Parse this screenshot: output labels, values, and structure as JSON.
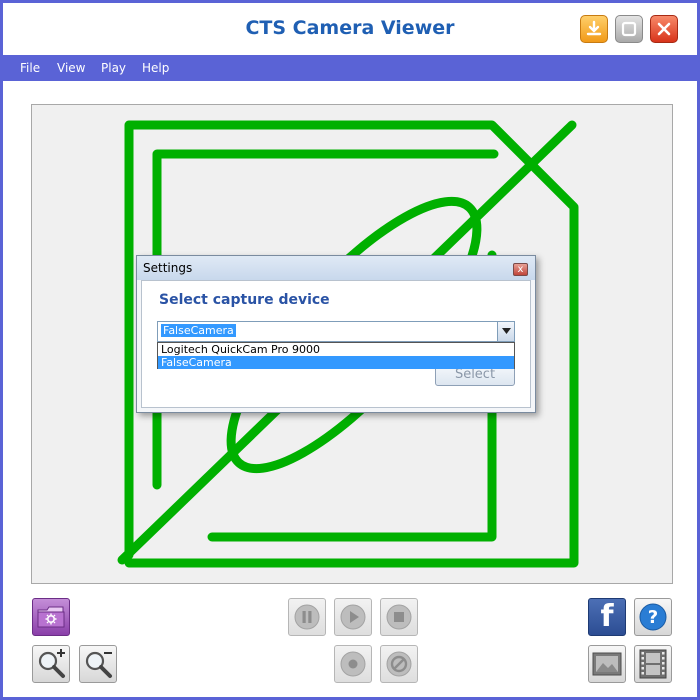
{
  "window": {
    "title": "CTS Camera Viewer"
  },
  "menu": {
    "items": [
      "File",
      "View",
      "Play",
      "Help"
    ]
  },
  "dialog": {
    "title": "Settings",
    "close_glyph": "x",
    "heading": "Select capture device",
    "combo_value": "FalseCamera",
    "options": [
      "Logitech QuickCam Pro 9000",
      "FalseCamera"
    ],
    "selected_index": 1,
    "select_label": "Select"
  },
  "colors": {
    "accent": "#5a63d6",
    "title_text": "#1f5fb3",
    "placeholder_green": "#00b000",
    "dialog_heading": "#2a53a5",
    "selection": "#3399ff"
  },
  "toolbar": {
    "icons": [
      "folder-settings-icon",
      "zoom-in-icon",
      "zoom-out-icon",
      "pause-icon",
      "play-icon",
      "stop-icon",
      "record-icon",
      "disable-icon",
      "facebook-icon",
      "help-icon",
      "snapshot-icon",
      "film-icon"
    ],
    "facebook_glyph": "f",
    "help_glyph": "?"
  }
}
